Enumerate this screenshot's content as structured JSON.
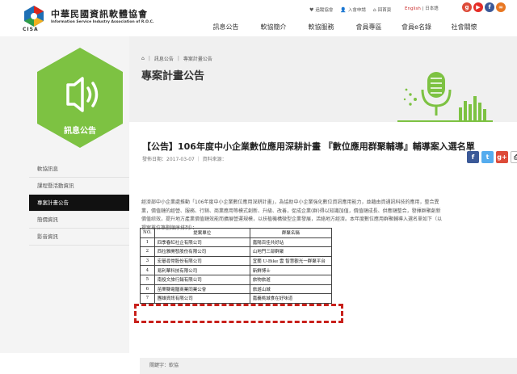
{
  "header": {
    "logo_zh": "中華民國資訊軟體協會",
    "logo_en": "Information Service Industry Association of R.O.C.",
    "logo_abbr": "CISA",
    "top_links": [
      {
        "icon": "heart-icon",
        "label": "追蹤協會"
      },
      {
        "icon": "user-icon",
        "label": "入會申請"
      },
      {
        "icon": "home-icon",
        "label": "回首頁"
      }
    ],
    "lang_en": "English",
    "lang_sep": " | ",
    "lang_ja": "日本語",
    "social": [
      {
        "name": "google-plus",
        "glyph": "g",
        "color": "#dd4b39"
      },
      {
        "name": "youtube",
        "glyph": "▶",
        "color": "#e52d27"
      },
      {
        "name": "facebook",
        "glyph": "f",
        "color": "#3b5998"
      },
      {
        "name": "link",
        "glyph": "∞",
        "color": "#e87722"
      }
    ],
    "nav": [
      "訊息公告",
      "軟協簡介",
      "軟協服務",
      "會員專區",
      "會員e名錄",
      "社會關懷"
    ]
  },
  "sidebar": {
    "section_label": "訊息公告",
    "hex_color": "#7dc242",
    "items": [
      {
        "label": "軟協訊息",
        "active": false
      },
      {
        "label": "課程暨活動資訊",
        "active": false
      },
      {
        "label": "專案計畫公告",
        "active": true
      },
      {
        "label": "簡價資訊",
        "active": false
      },
      {
        "label": "影音資訊",
        "active": false
      }
    ]
  },
  "content": {
    "breadcrumb": [
      "訊息公告",
      "專案計畫公告"
    ],
    "page_title": "專案計畫公告",
    "article_title": "【公告】106年度中小企業數位應用深耕計畫 『數位應用群聚輔導』輔導案入選名單",
    "meta": "發佈日期：2017-03-07 ｜ 資料來源：",
    "share": [
      {
        "name": "facebook",
        "glyph": "f",
        "color": "#3b5998"
      },
      {
        "name": "twitter",
        "glyph": "t",
        "color": "#55acee"
      },
      {
        "name": "google-plus",
        "glyph": "g+",
        "color": "#dd4b39"
      },
      {
        "name": "print",
        "glyph": "⎙",
        "color": "#ffffff"
      }
    ],
    "paragraph": [
      "經濟部中小企業處推動「106年度中小企業數位應用深耕計畫」，為協助中小企業強化數位資訊應用能力，並藉由資通訊科技的應用，整合異",
      "業，價值鏈的經營、服務、行銷、商業應用等模式創新、升級、改善，促成企業(群)得以知識加值，價值鏈成長、供應鏈整合，發揮群聚創新",
      "價值綜效，提升地方產業價值鏈效能而擴展營運規模，以扶植機構微型企業發展，活絡地方經濟。本年度數位應用群聚輔導入選名單如下（以",
      "提案單位筆劃順序排列）："
    ],
    "table": {
      "headers": [
        "NO.",
        "提案單位",
        "群聚名稱"
      ],
      "rows": [
        [
          "1",
          "四季春紅社企有限公司",
          "嘉陽百佳共好站"
        ],
        [
          "2",
          "西拉雅開發股份有限公司",
          "山地門三部群聚"
        ],
        [
          "3",
          "宏碁尋常股份有限公司",
          "宜蘭 U-Bike 雲 智慧觀光一群聚平台"
        ],
        [
          "4",
          "易利華科技有限公司",
          "新鮮博士"
        ],
        [
          "5",
          "南投文旅行銷有限公司",
          "旅物旅遊"
        ],
        [
          "6",
          "苗栗縣電腦商業同業公會",
          "旅遊山城"
        ],
        [
          "7",
          "團雄資訊有限公司",
          "嘉義桃城食在好味道"
        ]
      ]
    },
    "tags_label": "關鍵字：",
    "tags_value": "軟協"
  }
}
